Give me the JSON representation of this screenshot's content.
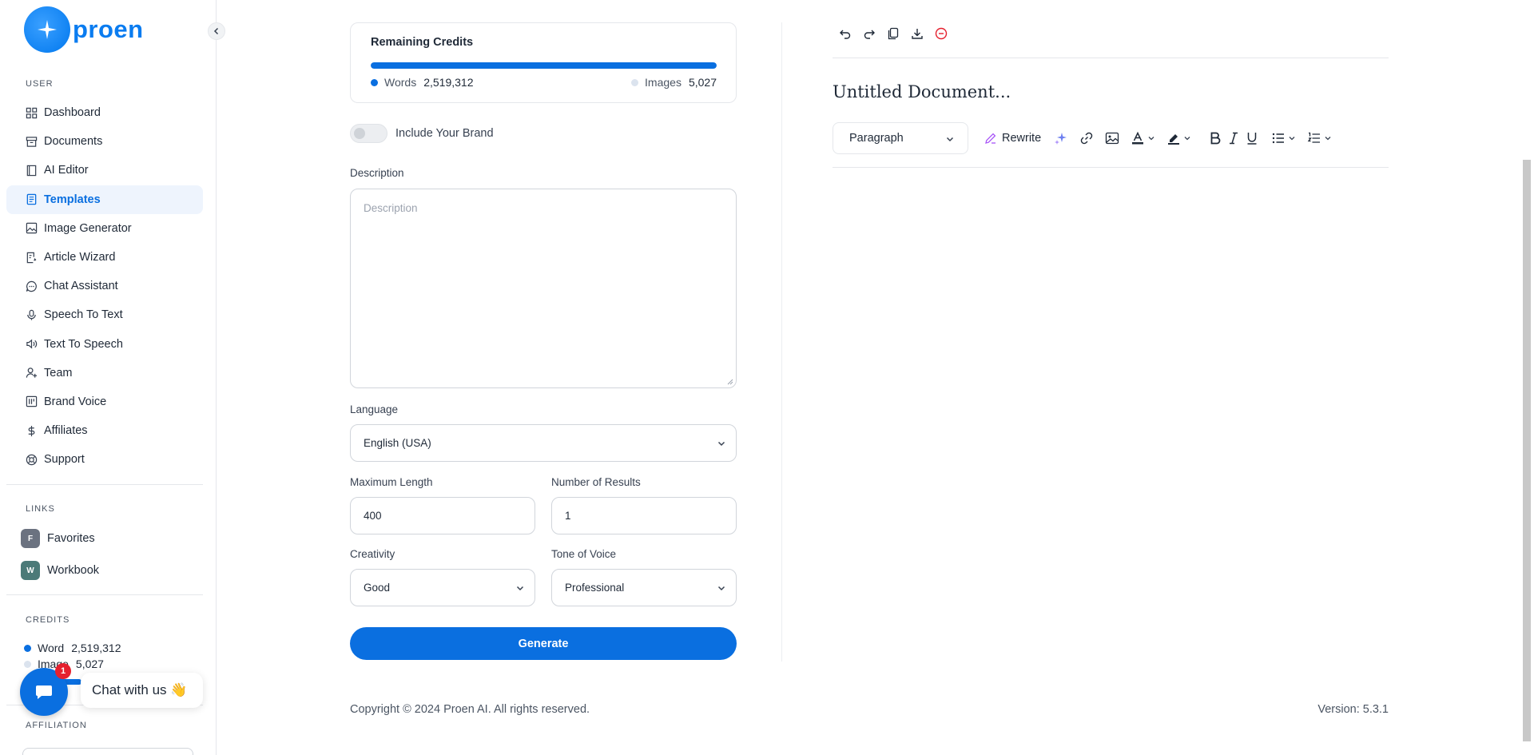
{
  "brand": {
    "name": "proen"
  },
  "sidebar": {
    "user_label": "USER",
    "items": [
      {
        "label": "Dashboard",
        "icon": "dashboard-icon"
      },
      {
        "label": "Documents",
        "icon": "documents-icon"
      },
      {
        "label": "AI Editor",
        "icon": "ai-editor-icon"
      },
      {
        "label": "Templates",
        "icon": "templates-icon",
        "active": true
      },
      {
        "label": "Image Generator",
        "icon": "image-icon"
      },
      {
        "label": "Article Wizard",
        "icon": "article-wizard-icon"
      },
      {
        "label": "Chat Assistant",
        "icon": "chat-icon"
      },
      {
        "label": "Speech To Text",
        "icon": "microphone-icon"
      },
      {
        "label": "Text To Speech",
        "icon": "speaker-icon"
      },
      {
        "label": "Team",
        "icon": "user-plus-icon"
      },
      {
        "label": "Brand Voice",
        "icon": "brand-voice-icon"
      },
      {
        "label": "Affiliates",
        "icon": "dollar-icon"
      },
      {
        "label": "Support",
        "icon": "lifebuoy-icon"
      }
    ],
    "links_label": "LINKS",
    "links": [
      {
        "badge": "F",
        "label": "Favorites",
        "color": "#6b7280"
      },
      {
        "badge": "W",
        "label": "Workbook",
        "color": "#4b7a78"
      }
    ],
    "credits_label": "CREDITS",
    "credits": {
      "word_label": "Word",
      "word_value": "2,519,312",
      "image_label": "Image",
      "image_value": "5,027"
    },
    "affiliation_label": "AFFILIATION"
  },
  "chat": {
    "badge": "1",
    "bubble": "Chat with us 👋"
  },
  "form": {
    "credits_card": {
      "title": "Remaining Credits",
      "words_label": "Words",
      "words_value": "2,519,312",
      "images_label": "Images",
      "images_value": "5,027",
      "words_fraction": 1.0
    },
    "brand_toggle_label": "Include Your Brand",
    "brand_toggle_on": false,
    "description_label": "Description",
    "description_placeholder": "Description",
    "language_label": "Language",
    "language_value": "English (USA)",
    "max_length_label": "Maximum Length",
    "max_length_value": "400",
    "results_label": "Number of Results",
    "results_value": "1",
    "creativity_label": "Creativity",
    "creativity_value": "Good",
    "tone_label": "Tone of Voice",
    "tone_value": "Professional",
    "generate_label": "Generate"
  },
  "editor": {
    "title": "Untitled Document...",
    "paragraph_label": "Paragraph",
    "rewrite_label": "Rewrite"
  },
  "footer": {
    "copyright": "Copyright © 2024 Proen AI. All rights reserved.",
    "version": "Version: 5.3.1"
  },
  "colors": {
    "accent": "#0a6fe0",
    "active_bg": "#eef4fd",
    "danger": "#e5202e"
  }
}
